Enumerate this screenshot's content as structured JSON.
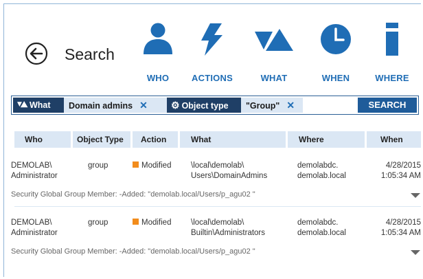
{
  "header": {
    "title": "Search",
    "categories": [
      {
        "label": "WHO",
        "icon": "person-icon"
      },
      {
        "label": "ACTIONS",
        "icon": "lightning-icon"
      },
      {
        "label": "WHAT",
        "icon": "shapes-icon"
      },
      {
        "label": "WHEN",
        "icon": "clock-icon"
      },
      {
        "label": "WHERE",
        "icon": "info-icon"
      }
    ]
  },
  "search_bar": {
    "chips": [
      {
        "field": "What",
        "field_icon": "shapes-icon",
        "value": "Domain admins"
      },
      {
        "field": "Object type",
        "field_icon": "gear-icon",
        "value": "\"Group\""
      }
    ],
    "search_label": "SEARCH"
  },
  "table": {
    "columns": [
      "Who",
      "Object Type",
      "Action",
      "What",
      "Where",
      "When"
    ],
    "rows": [
      {
        "who_line1": "DEMOLAB\\",
        "who_line2": "Administrator",
        "object_type": "group",
        "action": "Modified",
        "what_line1": "\\local\\demolab\\",
        "what_line2": "Users\\DomainAdmins",
        "where_line1": "demolabdc.",
        "where_line2": "demolab.local",
        "when_line1": "4/28/2015",
        "when_line2": "1:05:34 AM",
        "detail": "Security Global Group Member: -Added: \"demolab.local/Users/p_agu02 \""
      },
      {
        "who_line1": "DEMOLAB\\",
        "who_line2": "Administrator",
        "object_type": "group",
        "action": "Modified",
        "what_line1": "\\local\\demolab\\",
        "what_line2": "Builtin\\Administrators",
        "where_line1": "demolabdc.",
        "where_line2": "demolab.local",
        "when_line1": "4/28/2015",
        "when_line2": "1:05:34 AM",
        "detail": "Security Global Group Member: -Added: \"demolab.local/Users/p_agu02 \""
      }
    ]
  },
  "colors": {
    "accent": "#1f6db5",
    "chip_dark": "#1f3f66",
    "modified": "#f28c1c"
  }
}
